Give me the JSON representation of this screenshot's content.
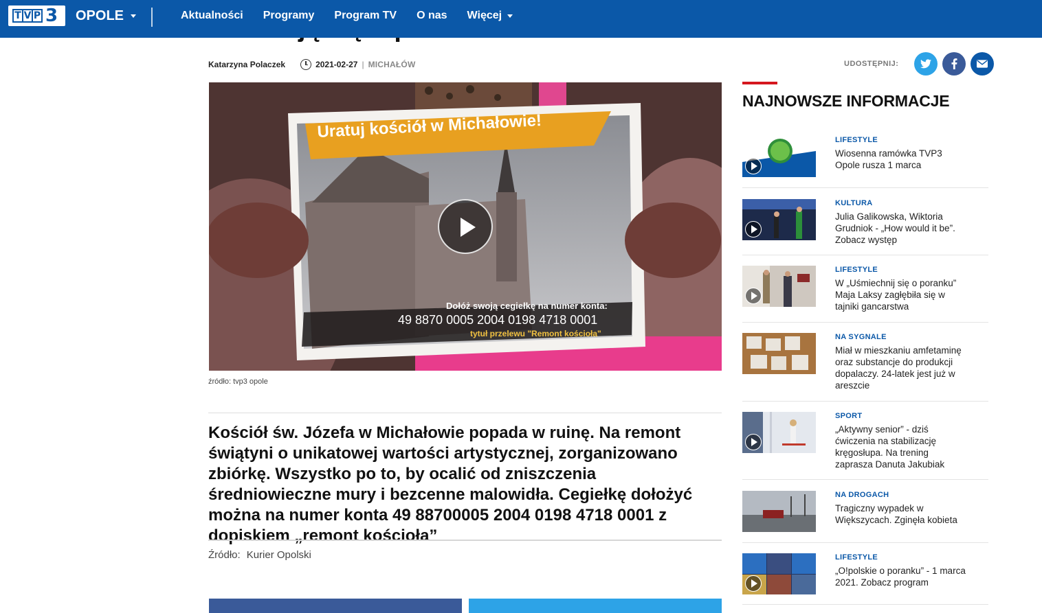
{
  "header": {
    "logo_text": "TVP",
    "logo_number": "3",
    "region": "OPOLE",
    "nav": [
      "Aktualności",
      "Programy",
      "Program TV",
      "O nas",
      "Więcej"
    ]
  },
  "article": {
    "headline_partial": "Zwracają się o pomoc",
    "author": "Katarzyna Polaczek",
    "date": "2021-02-27",
    "separator": "|",
    "location": "MICHAŁÓW",
    "share_label": "UDOSTĘPNIJ:",
    "video_caption": "źródło: tvp3 opole",
    "video_sign": {
      "title": "Uratuj kościół w Michałowie!",
      "line1": "Dołóż swoją cegiełkę na numer konta:",
      "account": "49 8870 0005 2004 0198 4718 0001",
      "line3": "tytuł przelewu \"Remont kościoła\""
    },
    "lead": "Kościół św. Józefa w Michałowie popada w ruinę. Na remont świątyni o unikatowej wartości artystycznej, zorganizowano zbiórkę. Wszystko po to, by ocalić od zniszczenia średniowieczne mury i bezcenne malowidła. Cegiełkę dołożyć można na numer konta 49 88700005 2004 0198 4718 0001 z dopiskiem „remont kościoła”",
    "source_label": "Źródło:",
    "source_value": "Kurier Opolski"
  },
  "sidebar": {
    "title": "NAJNOWSZE INFORMACJE",
    "items": [
      {
        "category": "LIFESTYLE",
        "title": "Wiosenna ramówka TVP3 Opole rusza 1 marca",
        "video": true
      },
      {
        "category": "KULTURA",
        "title": "Julia Galikowska, Wiktoria Grudniok - „How would it be”. Zobacz występ",
        "video": true
      },
      {
        "category": "LIFESTYLE",
        "title": "W „Uśmiechnij się o poranku” Maja Laksy zagłębiła się w tajniki gancarstwa",
        "video": true
      },
      {
        "category": "NA SYGNALE",
        "title": "Miał w mieszkaniu amfetaminę oraz substancje do produkcji dopalaczy. 24-latek jest już w areszcie",
        "video": false
      },
      {
        "category": "SPORT",
        "title": "„Aktywny senior” - dziś ćwiczenia na stabilizację kręgosłupa. Na trening zaprasza Danuta Jakubiak",
        "video": true
      },
      {
        "category": "NA DROGACH",
        "title": "Tragiczny wypadek w Większycach. Zginęła kobieta",
        "video": false
      },
      {
        "category": "LIFESTYLE",
        "title": "„O!polskie o poranku” - 1 marca 2021. Zobacz program",
        "video": true
      }
    ]
  },
  "colors": {
    "brand": "#0b58a8",
    "accent_red": "#d5171e",
    "twitter": "#2da3e7",
    "facebook": "#3a5a99"
  },
  "icons": [
    "clock-icon",
    "twitter-icon",
    "facebook-icon",
    "mail-icon",
    "play-icon",
    "chevron-down-icon"
  ]
}
